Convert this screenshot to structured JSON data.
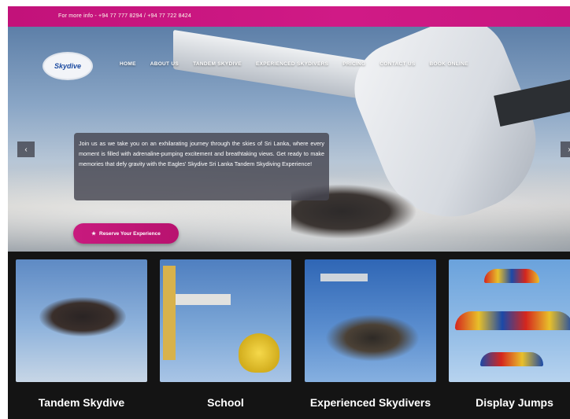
{
  "topbar": {
    "info_text": "For more info - +94 77 777 8294 / +94 77 722 8424"
  },
  "brand": {
    "logo_text": "Skydive"
  },
  "nav": {
    "items": [
      {
        "label": "HOME"
      },
      {
        "label": "ABOUT US"
      },
      {
        "label": "TANDEM SKYDIVE"
      },
      {
        "label": "EXPERIENCED SKYDIVERS"
      },
      {
        "label": "PRICING"
      },
      {
        "label": "CONTACT US"
      },
      {
        "label": "BOOK ONLINE"
      }
    ]
  },
  "hero": {
    "prev_icon": "chevron-left-icon",
    "next_icon": "chevron-right-icon",
    "caption": "Join us as we take you on an exhilarating journey through the skies of Sri Lanka, where every moment is filled with adrenaline-pumping excitement and breathtaking views. Get ready to make memories that defy gravity with the Eagles' Skydive Sri Lanka Tandem Skydiving Experience!",
    "cta_label": "Reserve Your Experience",
    "cta_icon": "trophy-icon"
  },
  "cards": [
    {
      "label": "Tandem Skydive"
    },
    {
      "label": "School"
    },
    {
      "label": "Experienced Skydivers"
    },
    {
      "label": "Display Jumps"
    }
  ],
  "colors": {
    "accent": "#c81a7e",
    "topbar": "#c2127a",
    "card_bg": "#141414"
  }
}
